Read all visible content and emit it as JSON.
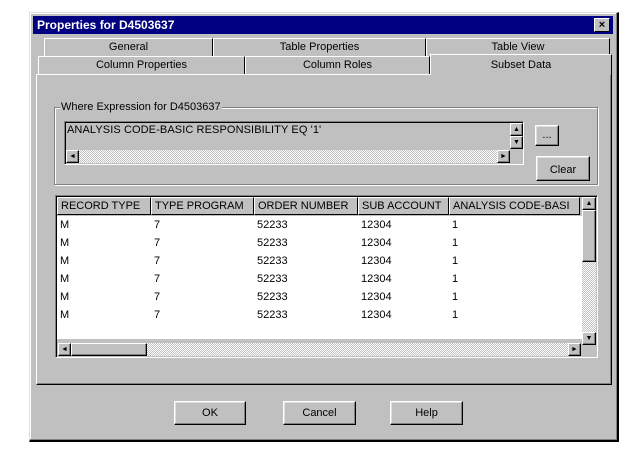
{
  "dialog": {
    "title": "Properties for D4503637",
    "close_glyph": "×"
  },
  "tabs": {
    "row1": [
      {
        "label": "General"
      },
      {
        "label": "Table Properties"
      },
      {
        "label": "Table View"
      }
    ],
    "row2": [
      {
        "label": "Column Properties"
      },
      {
        "label": "Column Roles"
      },
      {
        "label": "Subset Data",
        "active": true
      }
    ]
  },
  "subset": {
    "group_label": "Where Expression for D4503637",
    "expression": "ANALYSIS CODE-BASIC RESPONSIBILITY EQ '1'",
    "ellipsis_label": "...",
    "clear_label": "Clear"
  },
  "grid": {
    "columns": [
      "RECORD TYPE",
      "TYPE PROGRAM",
      "ORDER NUMBER",
      "SUB ACCOUNT",
      "ANALYSIS CODE-BASI"
    ],
    "rows": [
      [
        "M",
        "7",
        "52233",
        "12304",
        "1"
      ],
      [
        "M",
        "7",
        "52233",
        "12304",
        "1"
      ],
      [
        "M",
        "7",
        "52233",
        "12304",
        "1"
      ],
      [
        "M",
        "7",
        "52233",
        "12304",
        "1"
      ],
      [
        "M",
        "7",
        "52233",
        "12304",
        "1"
      ],
      [
        "M",
        "7",
        "52233",
        "12304",
        "1"
      ]
    ]
  },
  "buttons": {
    "ok": "OK",
    "cancel": "Cancel",
    "help": "Help"
  },
  "icons": {
    "arrow_up": "▲",
    "arrow_down": "▼",
    "arrow_left": "◄",
    "arrow_right": "►"
  },
  "colors": {
    "titlebar": "#000080",
    "face": "#c0c0c0"
  }
}
